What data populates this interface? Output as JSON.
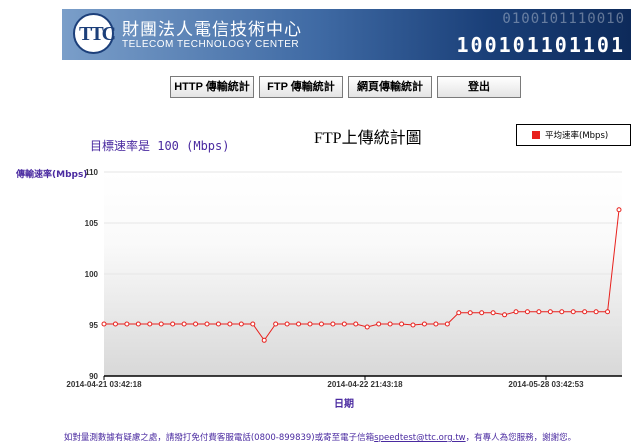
{
  "header": {
    "logo_text": "TTC",
    "org_name_zh": "財團法人電信技術中心",
    "org_name_en": "TELECOM TECHNOLOGY CENTER",
    "binary_top": "0100101110010",
    "binary_bottom": "100101101101"
  },
  "nav": [
    {
      "label": "HTTP 傳輸統計"
    },
    {
      "label": "FTP 傳輸統計"
    },
    {
      "label": "網頁傳輸統計"
    },
    {
      "label": "登出"
    }
  ],
  "target_rate": "目標速率是 100 (Mbps)",
  "colors": {
    "series": "#e8211d",
    "accent": "#4a2aa0",
    "banner": "#1a3f78"
  },
  "chart_data": {
    "type": "line",
    "title": "FTP上傳統計圖",
    "ylabel": "傳輸速率(Mbps)",
    "xlabel": "日期",
    "ylim": [
      90,
      110
    ],
    "yticks": [
      90,
      95,
      100,
      105,
      110
    ],
    "xtick_labels": [
      "2014-04-21 03:42:18",
      "2014-04-22 21:43:18",
      "2014-05-28 03:42:53"
    ],
    "legend_position": "top-right",
    "series": [
      {
        "name": "平均速率(Mbps)",
        "values": [
          95.1,
          95.1,
          95.1,
          95.1,
          95.1,
          95.1,
          95.1,
          95.1,
          95.1,
          95.1,
          95.1,
          95.1,
          95.1,
          95.1,
          93.5,
          95.1,
          95.1,
          95.1,
          95.1,
          95.1,
          95.1,
          95.1,
          95.1,
          94.8,
          95.1,
          95.1,
          95.1,
          95.0,
          95.1,
          95.1,
          95.1,
          96.2,
          96.2,
          96.2,
          96.2,
          96.0,
          96.3,
          96.3,
          96.3,
          96.3,
          96.3,
          96.3,
          96.3,
          96.3,
          96.3,
          106.3
        ]
      }
    ]
  },
  "footer": {
    "text_before": "如對量測數據有疑慮之處，請撥打免付費客服電話(0800-899839)或寄至電子信箱",
    "email": "speedtest@ttc.org.tw",
    "text_after": "，有專人為您服務，謝謝您。"
  }
}
